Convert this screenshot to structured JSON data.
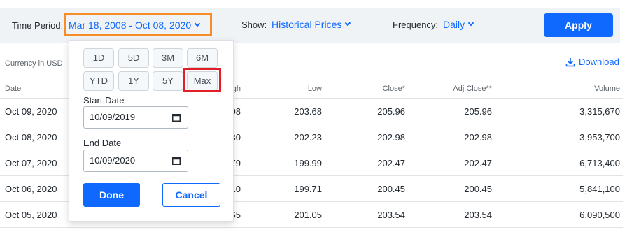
{
  "filter_bar": {
    "time_period_label": "Time Period:",
    "time_period_value": "Mar 18, 2008 - Oct 08, 2020",
    "show_label": "Show:",
    "show_value": "Historical Prices",
    "frequency_label": "Frequency:",
    "frequency_value": "Daily",
    "apply_label": "Apply"
  },
  "currency_text": "Currency in USD",
  "download_label": "Download",
  "table": {
    "headers": {
      "date": "Date",
      "high": "High",
      "low": "Low",
      "close": "Close*",
      "adj_close": "Adj Close**",
      "volume": "Volume"
    },
    "high_header_visible": "gh",
    "rows": [
      {
        "date": "Oct 09, 2020",
        "high_visible": "08",
        "low": "203.68",
        "close": "205.96",
        "adj_close": "205.96",
        "volume": "3,315,670"
      },
      {
        "date": "Oct 08, 2020",
        "high_visible": "30",
        "low": "202.23",
        "close": "202.98",
        "adj_close": "202.98",
        "volume": "3,953,700"
      },
      {
        "date": "Oct 07, 2020",
        "high_visible": "79",
        "low": "199.99",
        "close": "202.47",
        "adj_close": "202.47",
        "volume": "6,713,400"
      },
      {
        "date": "Oct 06, 2020",
        "high_visible": "10",
        "low": "199.71",
        "close": "200.45",
        "adj_close": "200.45",
        "volume": "5,841,100"
      },
      {
        "date": "Oct 05, 2020",
        "high_visible": "65",
        "low": "201.05",
        "close": "203.54",
        "adj_close": "203.54",
        "volume": "6,090,500"
      }
    ]
  },
  "date_popup": {
    "ranges": [
      "1D",
      "5D",
      "3M",
      "6M",
      "YTD",
      "1Y",
      "5Y",
      "Max"
    ],
    "start_label": "Start Date",
    "start_value": "10/09/2019",
    "end_label": "End Date",
    "end_value": "10/09/2020",
    "done_label": "Done",
    "cancel_label": "Cancel"
  },
  "colors": {
    "accent": "#0f69ff",
    "highlight_orange": "#f78d26",
    "highlight_red": "#e21e26",
    "bar_bg": "#f0f3f5"
  },
  "icons": [
    "chevron-down-icon",
    "download-icon",
    "calendar-icon"
  ]
}
